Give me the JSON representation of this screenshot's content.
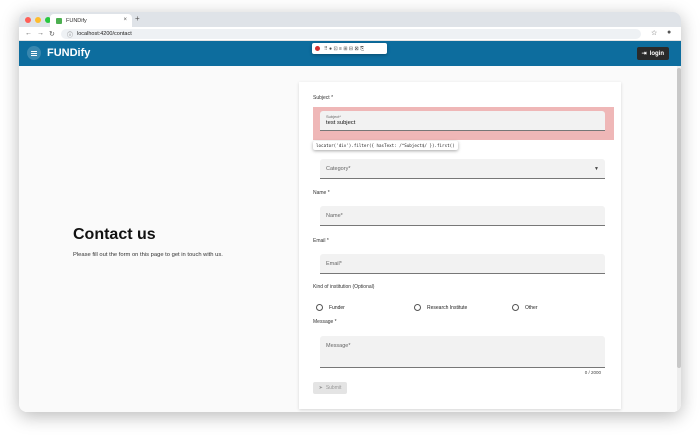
{
  "browser": {
    "tab_title": "FUNDify",
    "tab_close": "×",
    "new_tab": "+",
    "url": "localhost:4200/contact",
    "nav": {
      "back": "←",
      "forward": "→",
      "reload": "↻"
    },
    "star": "☆",
    "profile": "●"
  },
  "appbar": {
    "brand": "FUNDify",
    "login_label": "login",
    "login_icon": "⇥",
    "playwright_toolbar": "⠿ ● ⊡ ≡ ⊞ ⊟ ⊠ ⎘"
  },
  "hero": {
    "title": "Contact us",
    "subtitle": "Please fill out the form on this page to get in touch with us."
  },
  "form": {
    "subject_label": "Subject *",
    "subject_float": "Subject*",
    "subject_value": "test subject",
    "locator_tooltip": "locator('div').filter({ hasText: /^Subject$/ }).first()",
    "category_placeholder": "Category*",
    "category_caret": "▼",
    "name_label": "Name *",
    "name_placeholder": "Name*",
    "email_label": "Email *",
    "email_placeholder": "Email*",
    "institution_label": "Kind of institution (Optional)",
    "institution_options": [
      "Funder",
      "Research Institute",
      "Other"
    ],
    "message_label": "Message *",
    "message_placeholder": "Message*",
    "message_counter": "0 / 2000",
    "submit_label": "Submit",
    "submit_icon": "➤"
  }
}
